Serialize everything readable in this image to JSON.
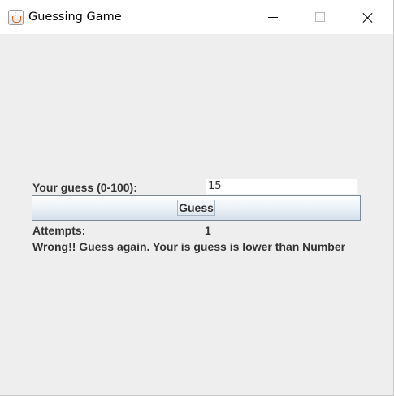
{
  "window": {
    "title": "Guessing Game",
    "icon": "java-coffee-cup-icon"
  },
  "form": {
    "guess_label": "Your guess (0-100):",
    "guess_value": "15",
    "guess_button_label": "Guess",
    "attempts_label": "Attempts:",
    "attempts_value": "1",
    "status_message": "Wrong!! Guess again. Your is guess is lower than Number"
  },
  "colors": {
    "background": "#eeeeee",
    "text": "#333333"
  }
}
